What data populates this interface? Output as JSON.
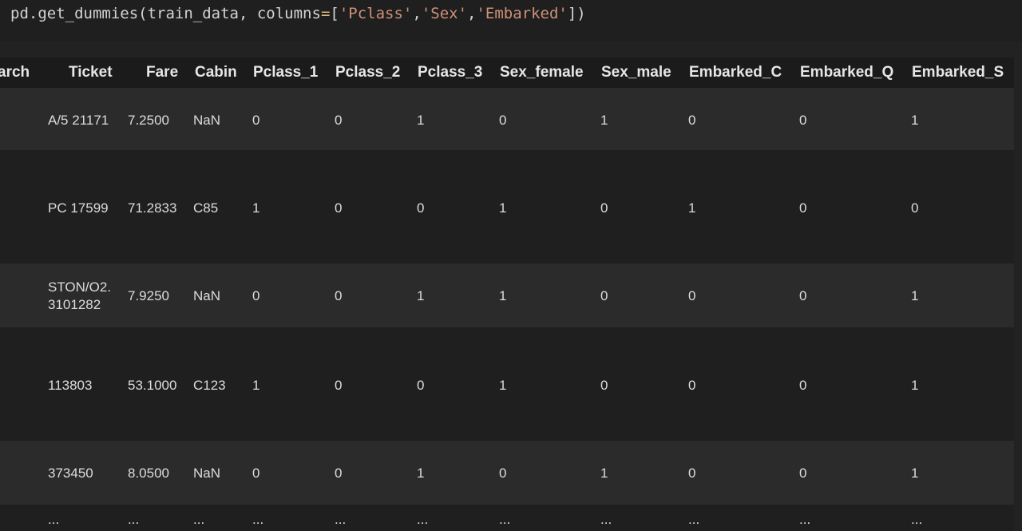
{
  "code": {
    "line_prefix": "pd.get_dummies(train_data, columns",
    "eq": "=",
    "open_bracket": "[",
    "arg1": "'Pclass'",
    "comma1": ",",
    "arg2": "'Sex'",
    "comma2": ",",
    "arg3": "'Embarked'",
    "close": "])"
  },
  "table": {
    "headers": [
      "arch",
      "Ticket",
      "Fare",
      "Cabin",
      "Pclass_1",
      "Pclass_2",
      "Pclass_3",
      "Sex_female",
      "Sex_male",
      "Embarked_C",
      "Embarked_Q",
      "Embarked_S"
    ],
    "rows": [
      [
        "",
        "A/5 21171",
        "7.2500",
        "NaN",
        "0",
        "0",
        "1",
        "0",
        "1",
        "0",
        "0",
        "1"
      ],
      [
        "",
        "PC 17599",
        "71.2833",
        "C85",
        "1",
        "0",
        "0",
        "1",
        "0",
        "1",
        "0",
        "0"
      ],
      [
        "",
        "STON/O2. 3101282",
        "7.9250",
        "NaN",
        "0",
        "0",
        "1",
        "1",
        "0",
        "0",
        "0",
        "1"
      ],
      [
        "",
        "113803",
        "53.1000",
        "C123",
        "1",
        "0",
        "0",
        "1",
        "0",
        "0",
        "0",
        "1"
      ],
      [
        "",
        "373450",
        "8.0500",
        "NaN",
        "0",
        "0",
        "1",
        "0",
        "1",
        "0",
        "0",
        "1"
      ],
      [
        "...",
        "...",
        "...",
        "...",
        "...",
        "...",
        "...",
        "...",
        "...",
        "...",
        "...",
        "..."
      ]
    ]
  },
  "colors": {
    "background": "#222222",
    "code_background": "#1f1f1f",
    "string": "#ce9178",
    "operator": "#d7ba7d"
  }
}
